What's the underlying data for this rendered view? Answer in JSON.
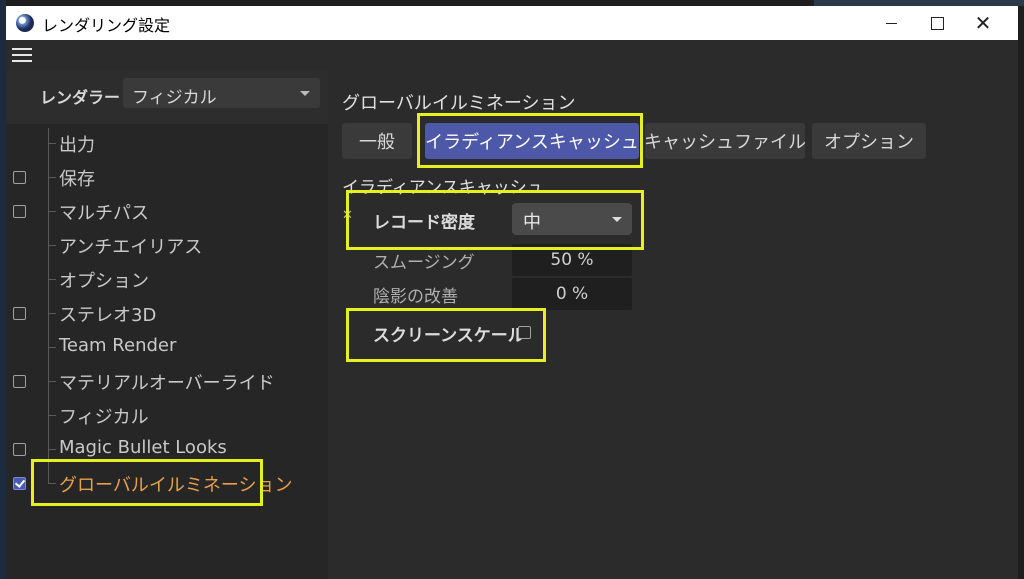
{
  "window": {
    "title": "レンダリング設定",
    "min_glyph": "",
    "max_glyph": "",
    "close_glyph": "✕"
  },
  "renderer": {
    "label": "レンダラー",
    "value": "フィジカル"
  },
  "tree": [
    {
      "label": "出力",
      "checkbox": null
    },
    {
      "label": "保存",
      "checkbox": false
    },
    {
      "label": "マルチパス",
      "checkbox": false
    },
    {
      "label": "アンチエイリアス",
      "checkbox": null
    },
    {
      "label": "オプション",
      "checkbox": null
    },
    {
      "label": "ステレオ3D",
      "checkbox": false
    },
    {
      "label": "Team Render",
      "checkbox": null
    },
    {
      "label": "マテリアルオーバーライド",
      "checkbox": false
    },
    {
      "label": "フィジカル",
      "checkbox": null
    },
    {
      "label": "Magic Bullet Looks",
      "checkbox": false
    },
    {
      "label": "グローバルイルミネーション",
      "checkbox": true,
      "active": true
    }
  ],
  "content": {
    "section_title": "グローバルイルミネーション",
    "tabs": [
      "一般",
      "イラディアンスキャッシュ",
      "キャッシュファイル",
      "オプション"
    ],
    "active_tab": "イラディアンスキャッシュ",
    "subsection_title": "イラディアンスキャッシュ",
    "collapse_mark": "✕",
    "fields": {
      "record_density": {
        "label": "レコード密度",
        "value": "中"
      },
      "smoothing": {
        "label": "スムージング",
        "value": "50 %"
      },
      "shading_improvement": {
        "label": "陰影の改善",
        "value": "0 %"
      },
      "screen_scale": {
        "label": "スクリーンスケール",
        "checked": false
      }
    }
  },
  "colors": {
    "highlight": "#e6f01e",
    "active_tab": "#4d58a8",
    "active_tree_item": "#e8a04a"
  }
}
